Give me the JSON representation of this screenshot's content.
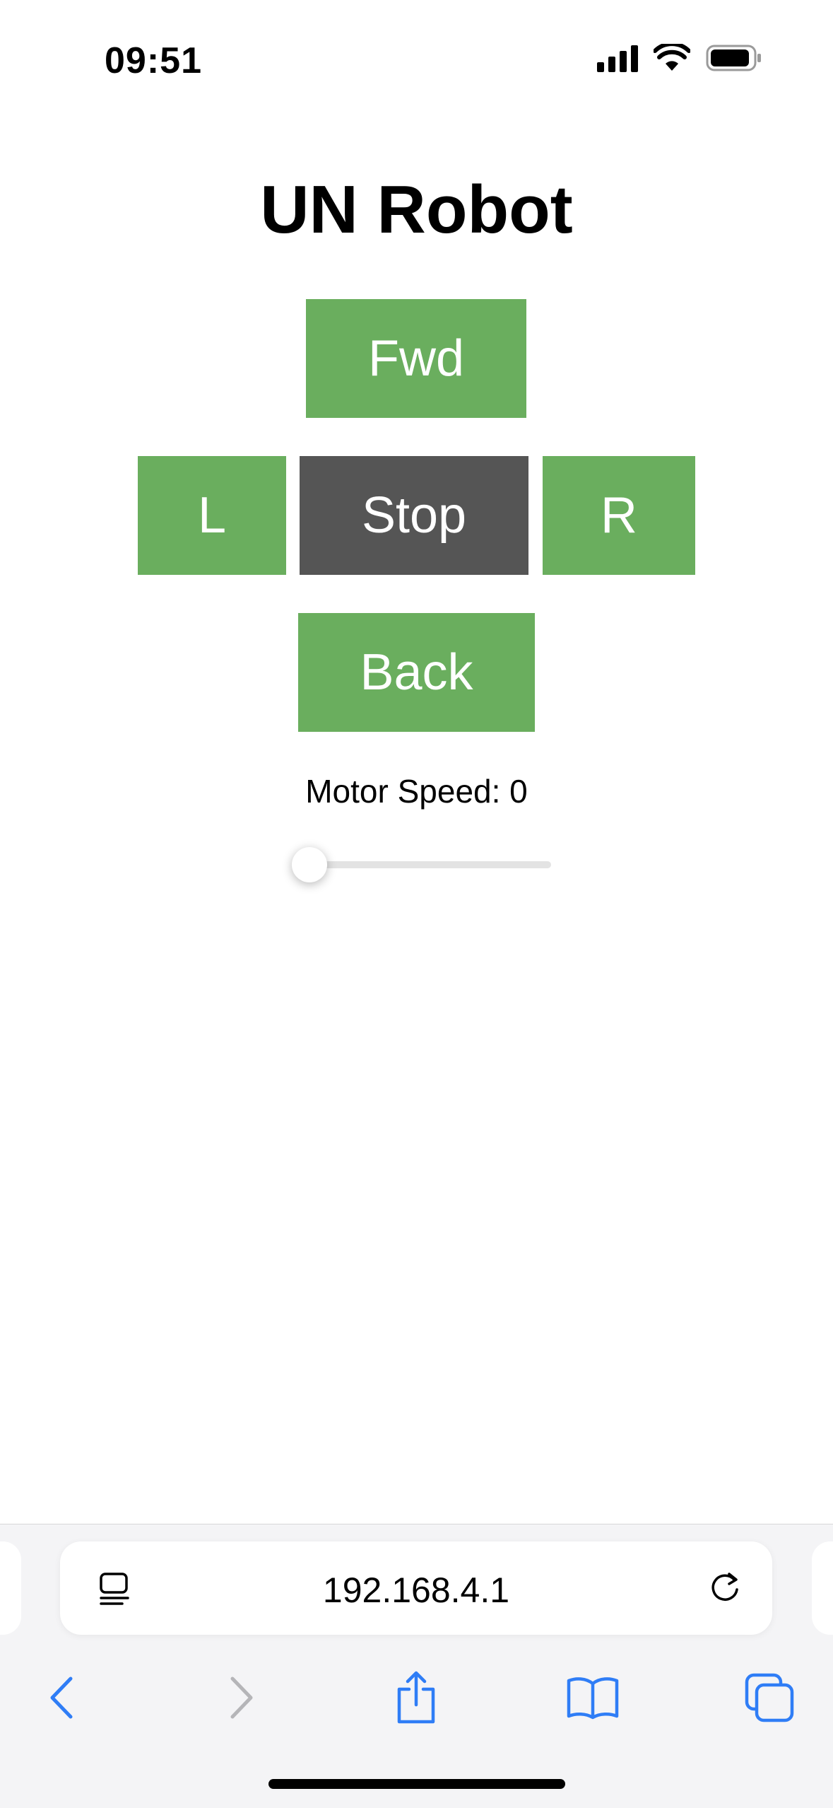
{
  "status_bar": {
    "time": "09:51",
    "icons": [
      "cellular-signal-icon",
      "wifi-icon",
      "battery-icon"
    ]
  },
  "page": {
    "title": "UN Robot",
    "buttons": {
      "forward": "Fwd",
      "left": "L",
      "stop": "Stop",
      "right": "R",
      "back": "Back"
    },
    "speed": {
      "label": "Motor Speed: 0",
      "value": 0,
      "min": 0,
      "max": 100
    },
    "colors": {
      "button_green": "#6aae5e",
      "stop_gray": "#555555"
    }
  },
  "browser": {
    "url": "192.168.4.1",
    "accent_color": "#2f7df6",
    "toolbar_icons": [
      "back-icon",
      "forward-icon",
      "share-icon",
      "bookmarks-icon",
      "tabs-icon"
    ]
  }
}
